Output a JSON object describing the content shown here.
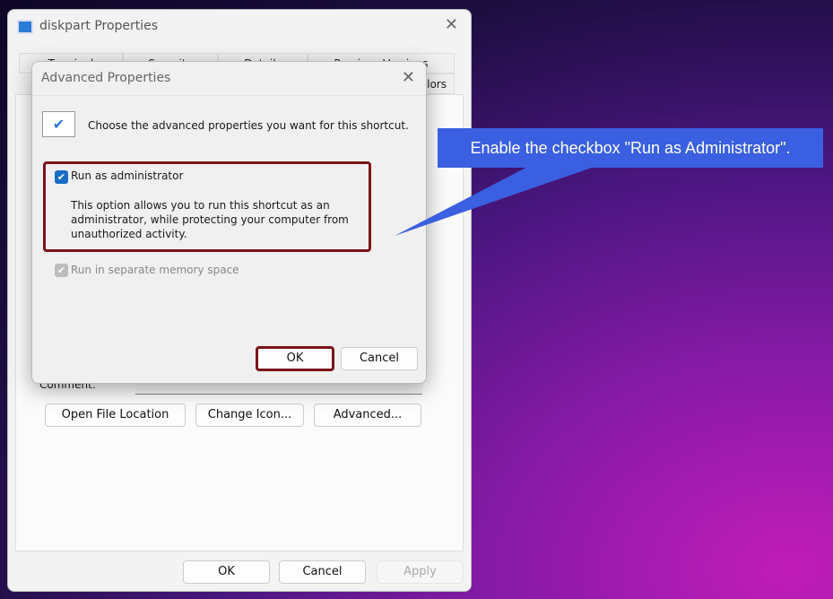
{
  "properties_window": {
    "title": "diskpart Properties",
    "tabs_row1": [
      "Terminal",
      "Security",
      "Details",
      "Previous Versions"
    ],
    "tabs_row2": [
      "Colors"
    ],
    "comment_label": "Comment:",
    "buttons": {
      "open_file_location": "Open File Location",
      "change_icon": "Change Icon...",
      "advanced": "Advanced..."
    },
    "footer": {
      "ok": "OK",
      "cancel": "Cancel",
      "apply": "Apply"
    }
  },
  "advanced_dialog": {
    "title": "Advanced Properties",
    "intro": "Choose the advanced properties you want for this shortcut.",
    "run_as_admin": {
      "label": "Run as administrator",
      "checked": true,
      "description": "This option allows you to run this shortcut as an administrator, while protecting your computer from unauthorized activity."
    },
    "separate_memory": {
      "label": "Run in separate memory space",
      "checked": true,
      "disabled": true
    },
    "ok": "OK",
    "cancel": "Cancel"
  },
  "callout": {
    "text": "Enable the checkbox \"Run as Administrator\".",
    "color": "#3a5fe0"
  },
  "highlight_color": "#7a1419"
}
